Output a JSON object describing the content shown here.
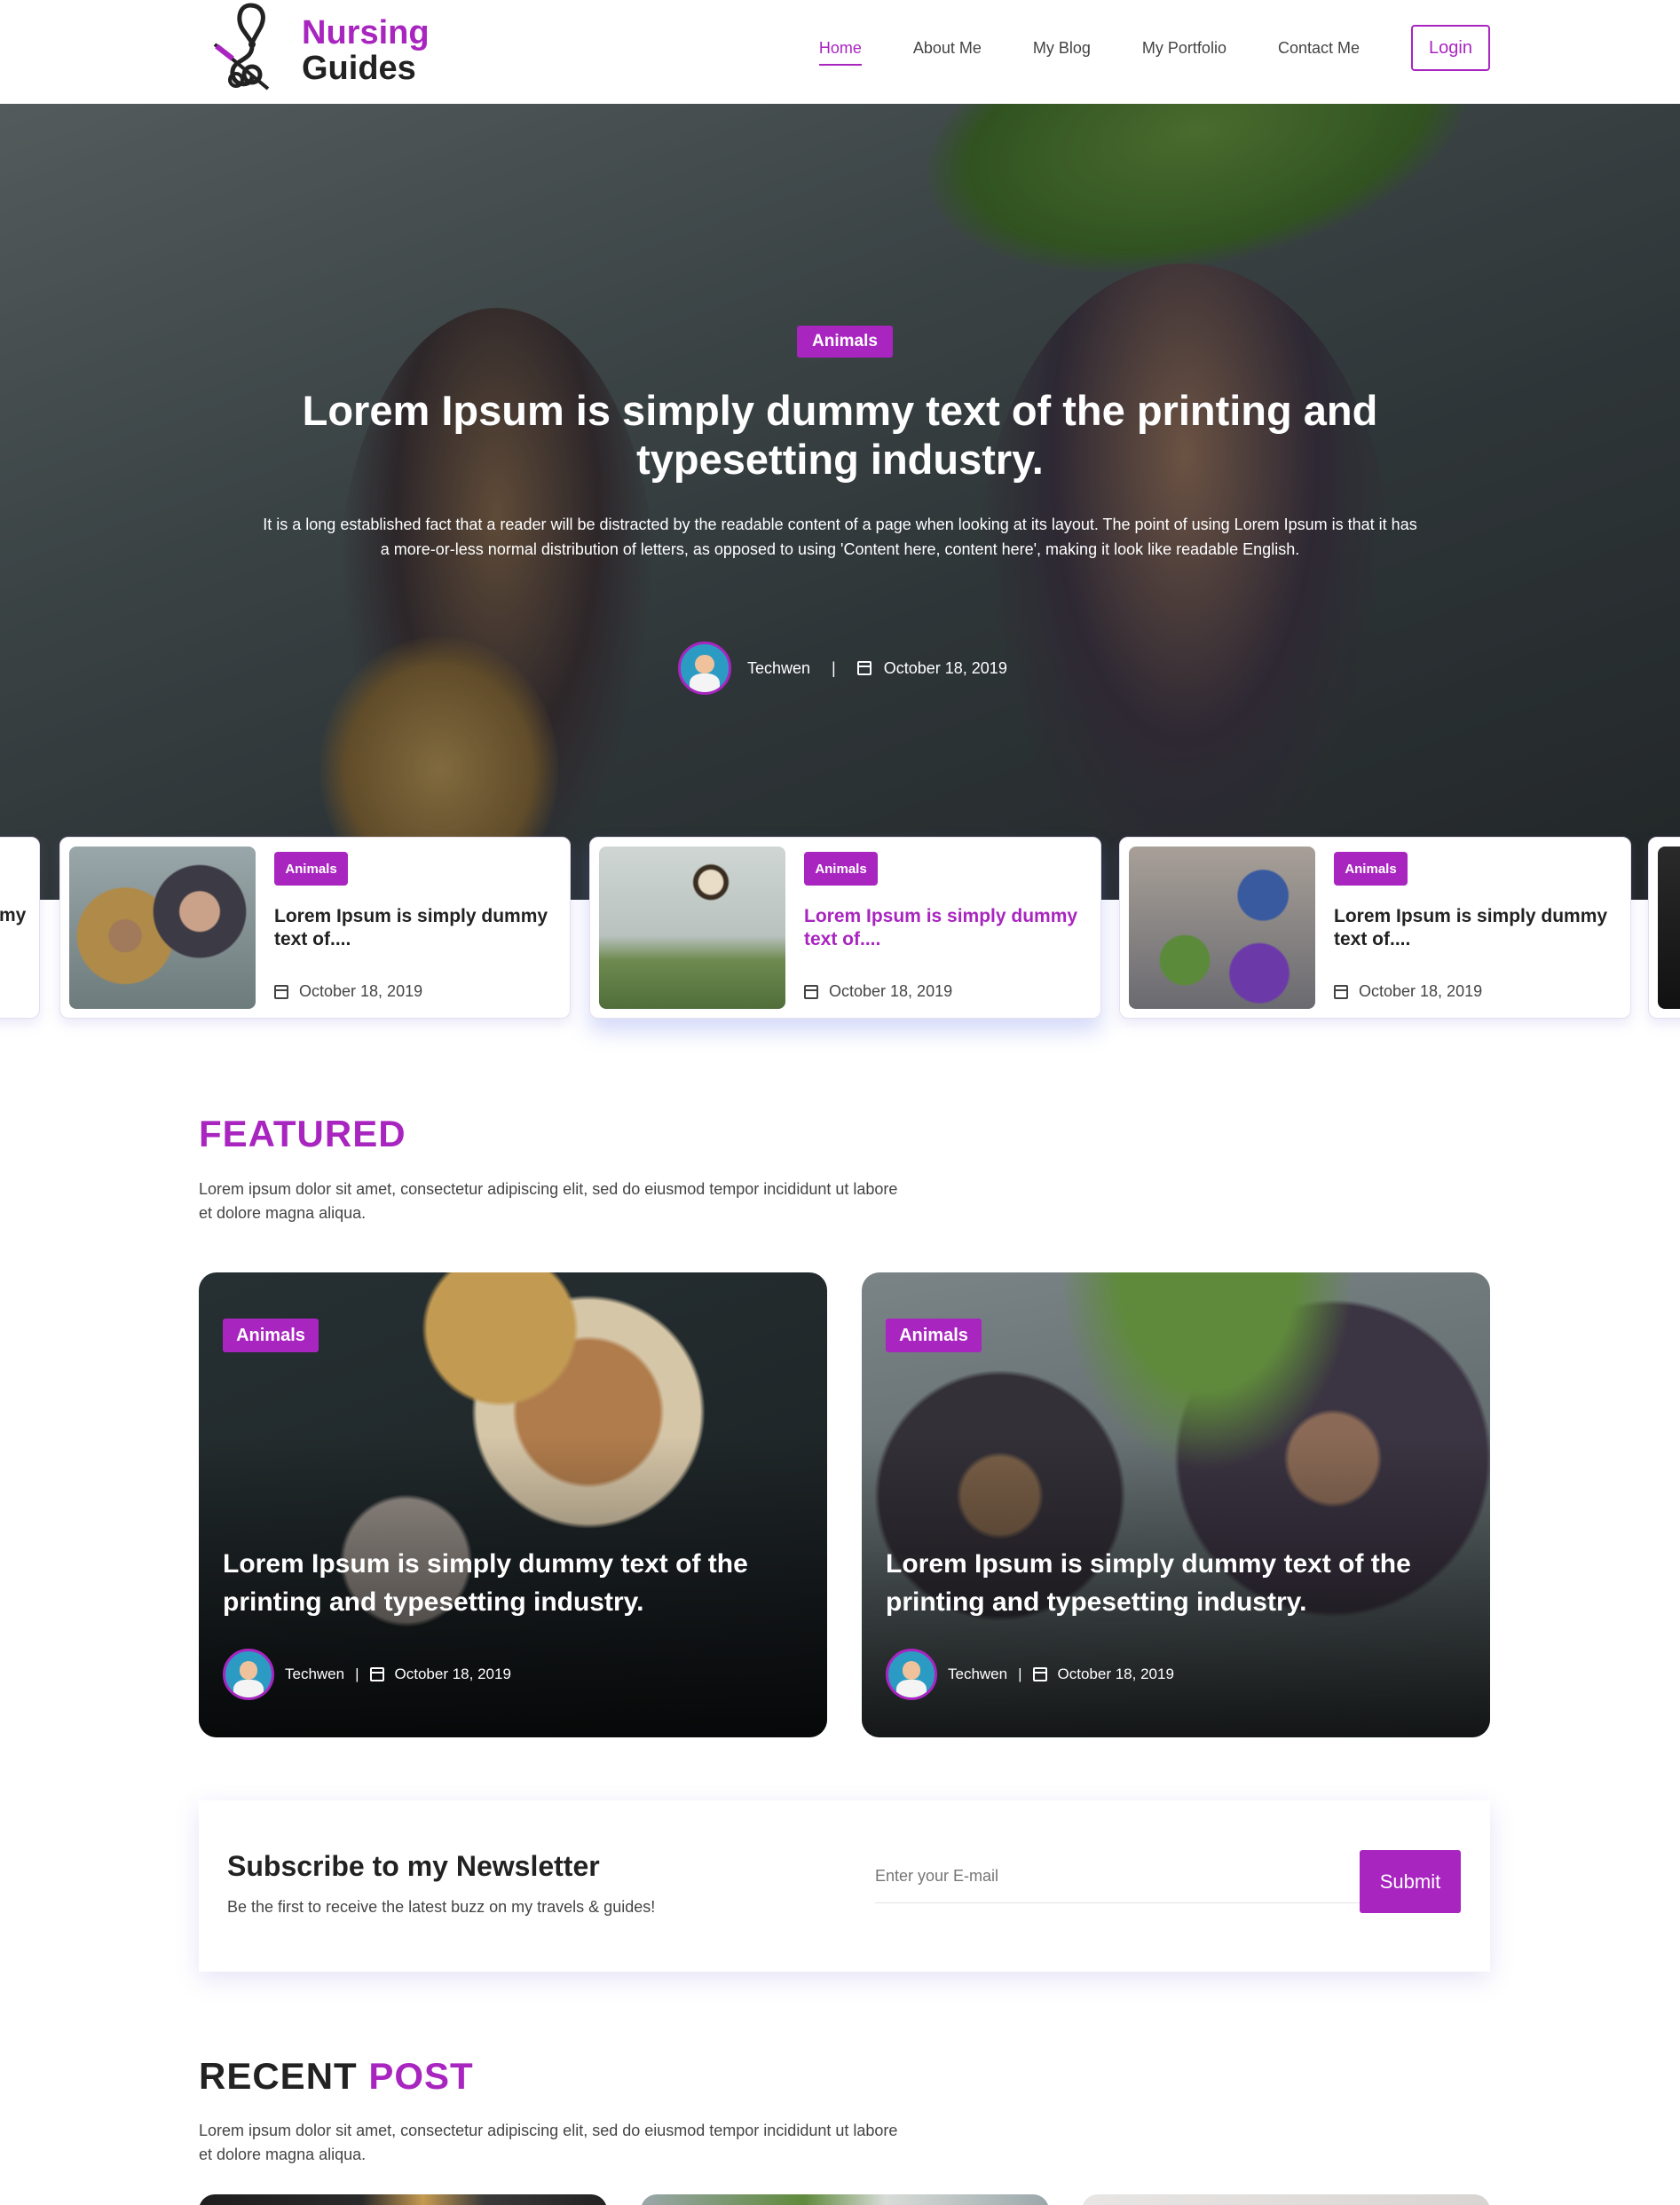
{
  "header": {
    "logo_line1": "Nursing",
    "logo_line2": "Guides",
    "nav": [
      "Home",
      "About Me",
      "My Blog",
      "My Portfolio",
      "Contact Me"
    ],
    "active_nav": "Home",
    "login_label": "Login"
  },
  "hero": {
    "badge": "Animals",
    "title": "Lorem Ipsum is simply dummy text of the printing and typesetting industry.",
    "description": "It is a long established fact that a reader will be distracted by the readable content of a page when looking at its layout. The point of using Lorem Ipsum is that it has a more-or-less normal distribution of letters, as opposed to using 'Content here, content here', making it look like readable English.",
    "author": "Techwen",
    "separator": "|",
    "date": "October 18, 2019"
  },
  "slider": {
    "partial_left_text": "my",
    "cards": [
      {
        "tag": "Animals",
        "title": "Lorem Ipsum is simply dummy text of....",
        "date": "October 18, 2019"
      },
      {
        "tag": "Animals",
        "title": "Lorem Ipsum is simply dummy text of....",
        "date": "October 18, 2019"
      },
      {
        "tag": "Animals",
        "title": "Lorem Ipsum is simply dummy text of....",
        "date": "October 18, 2019"
      }
    ]
  },
  "featured": {
    "title": "FEATURED",
    "description": "Lorem ipsum dolor sit amet, consectetur adipiscing elit, sed do eiusmod tempor incididunt ut labore et dolore magna aliqua.",
    "cards": [
      {
        "tag": "Animals",
        "title": "Lorem Ipsum is simply dummy text of the printing and typesetting industry.",
        "author": "Techwen",
        "separator": "|",
        "date": "October 18, 2019"
      },
      {
        "tag": "Animals",
        "title": "Lorem Ipsum is simply dummy text of the printing and typesetting industry.",
        "author": "Techwen",
        "separator": "|",
        "date": "October 18, 2019"
      }
    ]
  },
  "newsletter": {
    "title": "Subscribe to my Newsletter",
    "subtitle": "Be the first to receive the latest buzz on my travels & guides!",
    "placeholder": "Enter your E-mail",
    "submit_label": "Submit"
  },
  "recent": {
    "title_part1": "RECENT",
    "title_part2": "POST",
    "description": "Lorem ipsum dolor sit amet, consectetur adipiscing elit, sed do eiusmod tempor incididunt ut labore et dolore magna aliqua."
  },
  "colors": {
    "accent": "#a925c0",
    "text_dark": "#222222",
    "text_body": "#444444"
  }
}
